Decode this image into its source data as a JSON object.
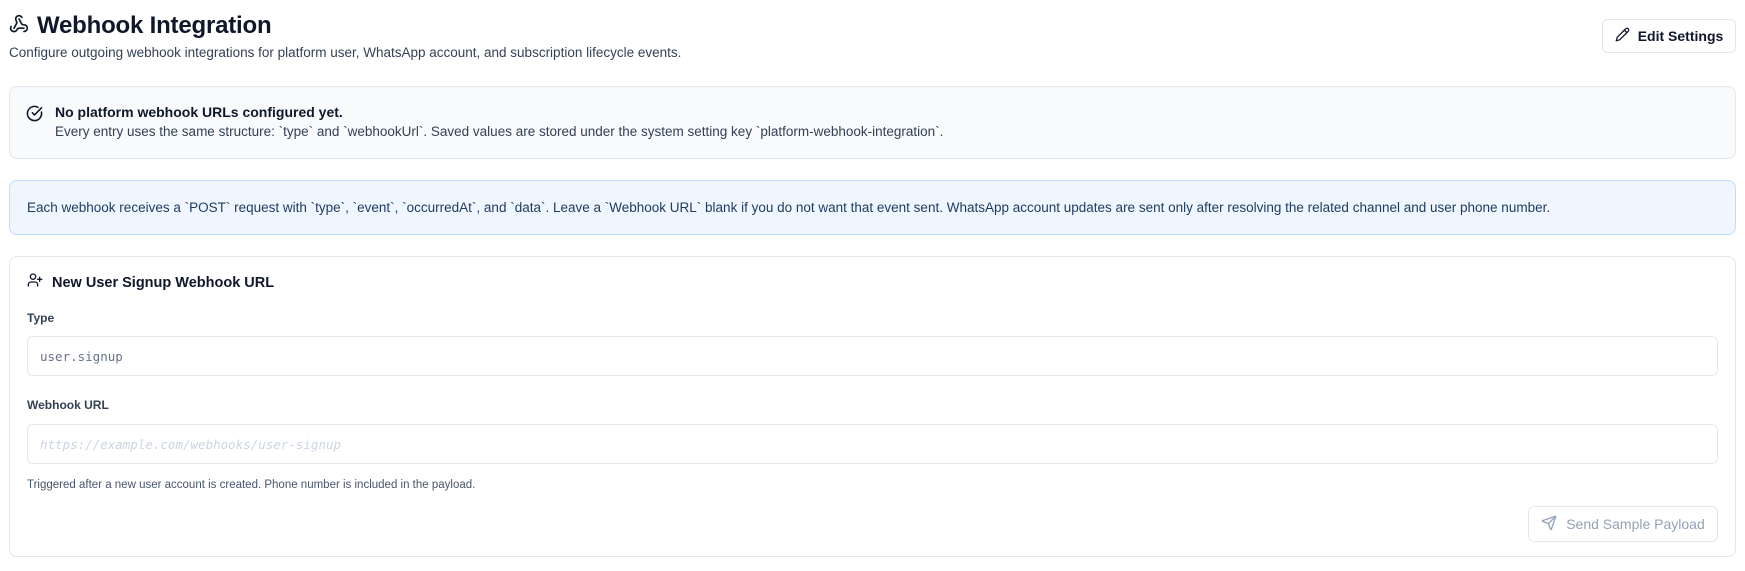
{
  "header": {
    "title": "Webhook Integration",
    "subtitle": "Configure outgoing webhook integrations for platform user, WhatsApp account, and subscription lifecycle events.",
    "edit_label": "Edit Settings",
    "title_icon": "webhook-icon",
    "edit_icon": "pencil-icon"
  },
  "notice": {
    "title": "No platform webhook URLs configured yet.",
    "description": "Every entry uses the same structure: `type` and `webhookUrl`. Saved values are stored under the system setting key `platform-webhook-integration`.",
    "icon": "check-circle-icon"
  },
  "info": {
    "text": "Each webhook receives a `POST` request with `type`, `event`, `occurredAt`, and `data`. Leave a `Webhook URL` blank if you do not want that event sent. WhatsApp account updates are sent only after resolving the related channel and user phone number."
  },
  "card": {
    "title": "New User Signup Webhook URL",
    "icon": "user-plus-icon",
    "type_label": "Type",
    "type_value": "user.signup",
    "url_label": "Webhook URL",
    "url_placeholder": "https://example.com/webhooks/user-signup",
    "hint": "Triggered after a new user account is created. Phone number is included in the payload.",
    "send_label": "Send Sample Payload",
    "send_icon": "send-icon"
  },
  "colors": {
    "info_bg": "#eff6ff",
    "info_border": "#bfdbfe",
    "notice_bg": "#f8fafc",
    "border": "#e2e8f0"
  }
}
